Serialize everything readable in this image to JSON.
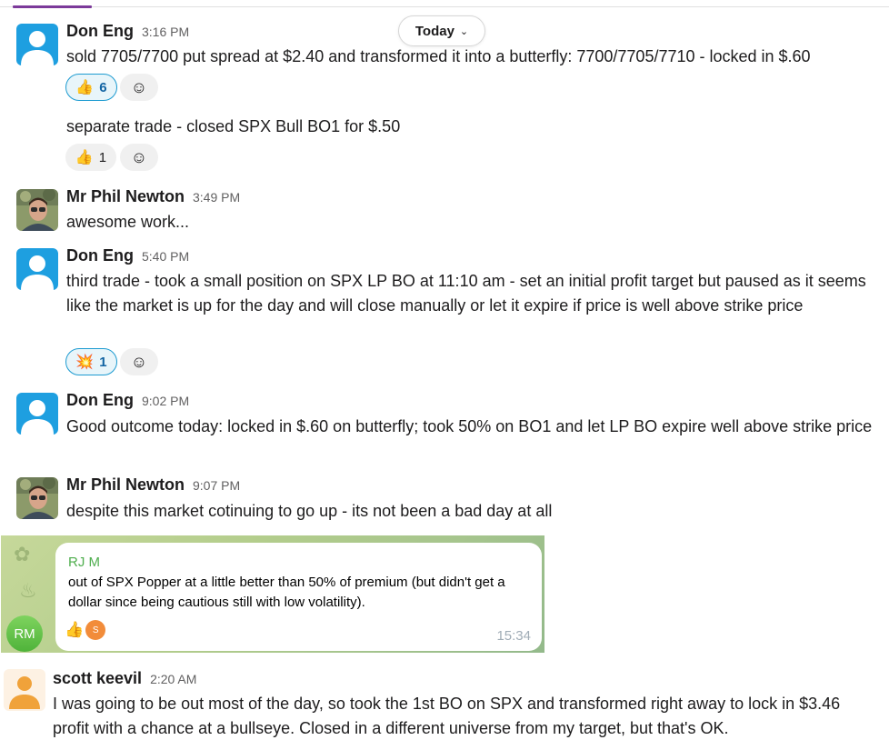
{
  "header": {
    "date_pill": "Today",
    "date_pill_icon": "chevron-down-icon"
  },
  "messages": [
    {
      "author": "Don Eng",
      "time": "3:16 PM",
      "text": "sold 7705/7700 put spread at $2.40 and transformed it into a butterfly: 7700/7705/7710 - locked in $.60",
      "reactions": [
        {
          "emoji": "👍",
          "count": "6",
          "active": true
        }
      ],
      "followup": {
        "text": "separate trade - closed SPX Bull BO1 for $.50",
        "reactions": [
          {
            "emoji": "👍",
            "count": "1",
            "active": false
          }
        ]
      }
    },
    {
      "author": "Mr Phil Newton",
      "time": "3:49 PM",
      "text": "awesome work..."
    },
    {
      "author": "Don Eng",
      "time": "5:40 PM",
      "text": "third trade - took a small position on SPX LP BO at 11:10 am - set an initial profit target but paused as it seems like the market is up for the day and will close manually or let it expire if price is well above strike price",
      "reactions": [
        {
          "emoji": "💥",
          "count": "1",
          "active": true
        }
      ]
    },
    {
      "author": "Don Eng",
      "time": "9:02 PM",
      "text": "Good outcome today: locked in $.60 on butterfly; took 50% on BO1 and let LP BO expire well above strike price"
    },
    {
      "author": "Mr Phil Newton",
      "time": "9:07 PM",
      "text": "despite this market cotinuing to go up - its not been a bad day at all"
    }
  ],
  "embed": {
    "avatar_initials": "RM",
    "sender": "RJ M",
    "text": "out of SPX Popper at a little better than 50% of premium (but didn't get a dollar since being cautious still with low volatility).",
    "reaction_emoji": "👍",
    "reaction_avatar": "S",
    "time": "15:34"
  },
  "last_message": {
    "author": "scott keevil",
    "time": "2:20 AM",
    "text": "I was going to be out most of the day, so took the 1st BO on SPX and transformed right away to lock in $3.46 profit with a chance at a bullseye. Closed in a different universe from my target, but that's OK."
  },
  "icons": {
    "add_reaction": "add-reaction-icon"
  },
  "colors": {
    "avatar_blue": "#1e9fe0",
    "reaction_active_border": "#1d9bd1",
    "reaction_active_text": "#1264a3",
    "telegram_name": "#4fae4e",
    "accent_purple": "#7c3a9a"
  }
}
